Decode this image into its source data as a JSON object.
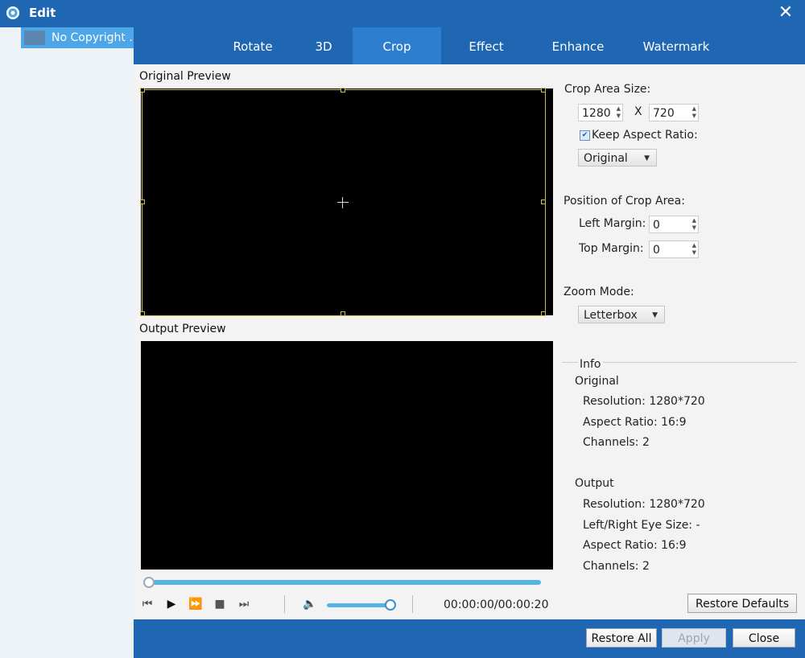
{
  "window": {
    "title": "Edit",
    "close_glyph": "✕"
  },
  "file_list": {
    "items": [
      {
        "name": "No Copyright ..."
      }
    ]
  },
  "tabs": [
    {
      "label": "Rotate",
      "active": false
    },
    {
      "label": "3D",
      "active": false
    },
    {
      "label": "Crop",
      "active": true
    },
    {
      "label": "Effect",
      "active": false
    },
    {
      "label": "Enhance",
      "active": false
    },
    {
      "label": "Watermark",
      "active": false
    }
  ],
  "preview": {
    "original_label": "Original Preview",
    "output_label": "Output Preview",
    "time": "00:00:00/00:00:20",
    "progress": 0,
    "volume": 0.9
  },
  "controls": {
    "skip_back_icon": "⏮",
    "play_icon": "▶",
    "fast_forward_icon": "⏩",
    "stop_icon": "■",
    "skip_forward_icon": "⏭",
    "volume_icon": "🔈"
  },
  "crop": {
    "area_size_label": "Crop Area Size:",
    "width": "1280",
    "x_sep": "X",
    "height": "720",
    "keep_aspect_label": "Keep Aspect Ratio:",
    "keep_aspect_checked": true,
    "aspect_value": "Original",
    "position_label": "Position of Crop Area:",
    "left_margin_label": "Left Margin:",
    "left_margin": "0",
    "top_margin_label": "Top Margin:",
    "top_margin": "0",
    "zoom_mode_label": "Zoom Mode:",
    "zoom_mode": "Letterbox"
  },
  "info": {
    "title": "Info",
    "original_title": "Original",
    "original_resolution": "Resolution: 1280*720",
    "original_aspect": "Aspect Ratio: 16:9",
    "original_channels": "Channels: 2",
    "output_title": "Output",
    "output_resolution": "Resolution: 1280*720",
    "output_eye_size": "Left/Right Eye Size: -",
    "output_aspect": "Aspect Ratio: 16:9",
    "output_channels": "Channels: 2"
  },
  "buttons": {
    "restore_defaults": "Restore Defaults",
    "restore_all": "Restore All",
    "apply": "Apply",
    "close": "Close"
  },
  "colors": {
    "titlebar": "#1f66b3",
    "active_tab": "#2e7ed0",
    "selection": "#4da6e8",
    "crop_frame": "#cdbf4c"
  }
}
